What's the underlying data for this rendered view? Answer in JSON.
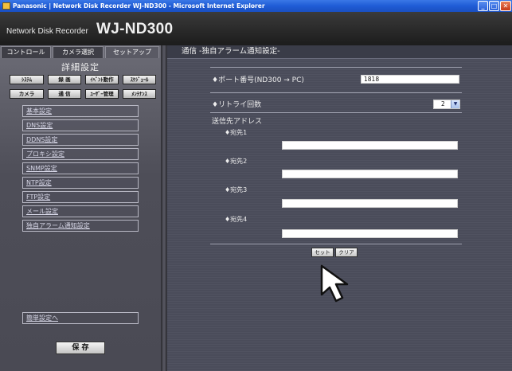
{
  "window": {
    "title": "Panasonic | Network Disk Recorder WJ-ND300 - Microsoft Internet Explorer",
    "controls": {
      "minimize": "_",
      "maximize": "□",
      "close": "✕"
    }
  },
  "app": {
    "subtitle": "Network Disk Recorder",
    "model": "WJ-ND300"
  },
  "tabs": [
    {
      "label": "コントロール"
    },
    {
      "label": "カメラ選択"
    },
    {
      "label": "セットアップ"
    }
  ],
  "sidebar": {
    "heading": "詳細設定",
    "menu_buttons": [
      {
        "label": "ｼｽﾃﾑ"
      },
      {
        "label": "録 画"
      },
      {
        "label": "ｲﾍﾞﾝﾄ動作"
      },
      {
        "label": "ｽｹｼﾞｭｰﾙ"
      },
      {
        "label": "カメラ"
      },
      {
        "label": "通 信"
      },
      {
        "label": "ﾕｰｻﾞｰ管理"
      },
      {
        "label": "ﾒﾝﾃﾅﾝｽ"
      }
    ],
    "sub_items": [
      {
        "label": "基本設定"
      },
      {
        "label": "DNS設定"
      },
      {
        "label": "DDNS設定"
      },
      {
        "label": "プロキシ設定"
      },
      {
        "label": "SNMP設定"
      },
      {
        "label": "NTP設定"
      },
      {
        "label": "FTP設定"
      },
      {
        "label": "メール設定"
      },
      {
        "label": "独自アラーム通知設定"
      }
    ],
    "simple_link": "簡単設定へ",
    "save_label": "保 存"
  },
  "main": {
    "header": "通信 -独自アラーム通知設定-",
    "port_label": "♦ポート番号(ND300 → PC)",
    "port_value": "1818",
    "retry_label": "♦リトライ回数",
    "retry_value": "2",
    "address_heading": "送信先アドレス",
    "destinations": [
      {
        "label": "♦宛先1",
        "value": ""
      },
      {
        "label": "♦宛先2",
        "value": ""
      },
      {
        "label": "♦宛先3",
        "value": ""
      },
      {
        "label": "♦宛先4",
        "value": ""
      }
    ],
    "set_label": "セット",
    "clear_label": "クリア"
  },
  "colors": {
    "titlebar": "#1f5cd6",
    "header_bg": "#1c1c1c",
    "sidebar_bg": "#5a5a64",
    "main_bg": "#4a4c5a"
  }
}
